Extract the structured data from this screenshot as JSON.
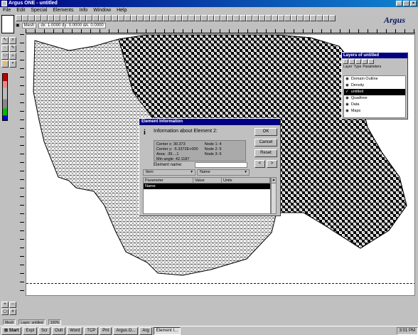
{
  "window": {
    "title": "Argus ONE - untitled"
  },
  "menu": [
    "File",
    "Edit",
    "Special",
    "Elements",
    "Info",
    "Window",
    "Help"
  ],
  "infobar": {
    "layer_field": "Mesh",
    "coords": "dx: 1.0000 dy: 0.0000 dA: 0.0000"
  },
  "logo": "Argus",
  "layers": {
    "title": "Layers of untitled",
    "tabs": [
      "Layer",
      "Type",
      "Parameters"
    ],
    "items": [
      {
        "name": "Domain Outline",
        "selected": false
      },
      {
        "name": "Density",
        "selected": false
      },
      {
        "name": "untitled",
        "selected": true
      },
      {
        "name": "Quadtree",
        "selected": false
      },
      {
        "name": "Data",
        "selected": false
      },
      {
        "name": "Maps",
        "selected": false
      }
    ]
  },
  "dialog": {
    "title": "Element Information",
    "heading": "Information about Element 2:",
    "ok_label": "OK",
    "cancel_label": "Cancel",
    "reset_label": "Reset",
    "next_label": ">",
    "prev_label": "<",
    "stats": {
      "centerx": "Center x:  30.373",
      "centery": "Center y:  -5.3372E+000",
      "area": "Area:  .39....1",
      "minangle": "Min angle:  42.1187",
      "node1": "Node 1:  4",
      "node2": "Node 2:  5",
      "node3": "Node 3:  6"
    },
    "element_name_label": "Element name:",
    "element_name_value": "",
    "select_left": "Item",
    "select_right": "Name",
    "columns": [
      "Parameter",
      "Value",
      "Units"
    ],
    "rows": [
      [
        "Name",
        "",
        ""
      ]
    ]
  },
  "status": {
    "left": "Mesh",
    "middle": "Layer: untitled",
    "zoom": "100%"
  },
  "taskbar": {
    "start": "Start",
    "tasks": [
      "Expl",
      "Scr",
      "Outl",
      "Word",
      "TCP",
      "Pnt",
      "Argus O...",
      "Arg",
      "Element I..."
    ],
    "active_index": 8,
    "clock": "3:01 PM"
  }
}
